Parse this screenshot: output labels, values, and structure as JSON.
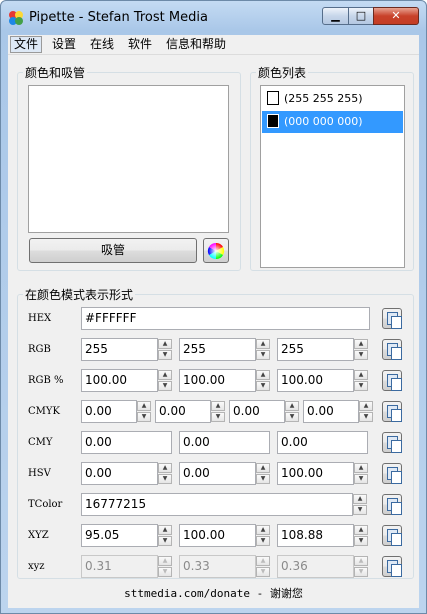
{
  "window": {
    "title": "Pipette - Stefan Trost Media"
  },
  "titlebar": {
    "minimize": "▁",
    "maximize": "□",
    "close": "✕"
  },
  "menu": [
    "文件",
    "设置",
    "在线",
    "软件",
    "信息和帮助"
  ],
  "picker_group": {
    "label": "颜色和吸管",
    "pipette_button": "吸管"
  },
  "color_list": {
    "label": "颜色列表",
    "items": [
      {
        "text": "(255 255 255)",
        "swatch": "#FFFFFF",
        "selected": false
      },
      {
        "text": "(000 000 000)",
        "swatch": "#000000",
        "selected": true
      }
    ]
  },
  "modes": {
    "label": "在颜色模式表示形式",
    "hex": {
      "label": "HEX",
      "value": "#FFFFFF"
    },
    "rgb": {
      "label": "RGB",
      "values": [
        "255",
        "255",
        "255"
      ]
    },
    "rgb_pct": {
      "label": "RGB %",
      "values": [
        "100.00",
        "100.00",
        "100.00"
      ]
    },
    "cmyk": {
      "label": "CMYK",
      "values": [
        "0.00",
        "0.00",
        "0.00",
        "0.00"
      ]
    },
    "cmy": {
      "label": "CMY",
      "values": [
        "0.00",
        "0.00",
        "0.00"
      ]
    },
    "hsv": {
      "label": "HSV",
      "values": [
        "0.00",
        "0.00",
        "100.00"
      ]
    },
    "tcolor": {
      "label": "TColor",
      "value": "16777215"
    },
    "xyz": {
      "label": "XYZ",
      "values": [
        "95.05",
        "100.00",
        "108.88"
      ]
    },
    "xyz_lower": {
      "label": "xyz",
      "values": [
        "0.31",
        "0.33",
        "0.36"
      ]
    }
  },
  "footer": "sttmedia.com/donate - 谢谢您",
  "icons": {
    "app": "pipette-app-icon",
    "color_wheel": "color-wheel-icon",
    "copy": "copy-icon"
  }
}
